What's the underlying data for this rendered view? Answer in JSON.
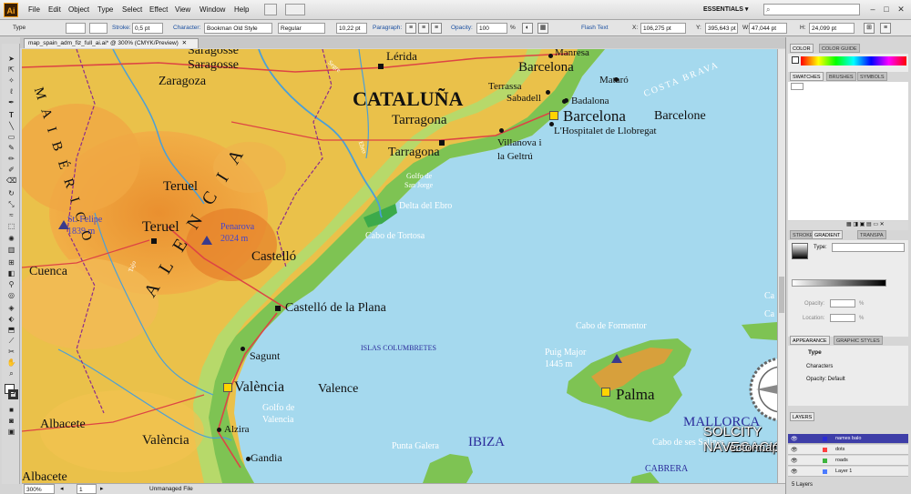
{
  "app": {
    "logo": "Ai",
    "menus": [
      "File",
      "Edit",
      "Object",
      "Type",
      "Select",
      "Effect",
      "View",
      "Window",
      "Help"
    ],
    "workspace": "ESSENTIALS ▾",
    "search_placeholder": "",
    "win_buttons": [
      "–",
      "□",
      "✕"
    ]
  },
  "control": {
    "type_label": "Type",
    "stroke_label": "Stroke:",
    "stroke_value": "0,5 pt",
    "character_label": "Character:",
    "font": "Bookman Old Style",
    "style": "Regular",
    "size": "10,22 pt",
    "paragraph_label": "Paragraph:",
    "opacity_label": "Opacity:",
    "opacity": "100",
    "opacity_unit": "%",
    "flash_label": "Flash Text",
    "x_label": "X:",
    "x": "106,275 pt",
    "y_label": "Y:",
    "y": "395,643 pt",
    "w_label": "W:",
    "w": "47,044 pt",
    "h_label": "H:",
    "h": "24,099 pt"
  },
  "document": {
    "tab": "map_spain_adm_fiz_full_ai.ai* @ 300% (CMYK/Preview)",
    "close": "✕"
  },
  "status": {
    "zoom": "300%",
    "page": "1",
    "info": "Unmanaged File"
  },
  "panels": {
    "color_tabs": [
      "COLOR",
      "COLOR GUIDE"
    ],
    "swatch_tabs": [
      "SWATCHES",
      "BRUSHES",
      "SYMBOLS"
    ],
    "stroke_tabs": [
      "STROKE",
      "GRADIENT",
      "TRANSPA"
    ],
    "type_label": "Type:",
    "opacity_label": "Opacity:",
    "location_label": "Location:",
    "pct": "%",
    "appearance_tabs": [
      "APPEARANCE",
      "GRAPHIC STYLES"
    ],
    "appearance_items": [
      "Type",
      "Characters",
      "Opacity: Default"
    ],
    "layers_tab": "LAYERS",
    "layers": [
      {
        "name": "names balo",
        "color": "#2b2bd6"
      },
      {
        "name": "dots",
        "color": "#ff4040"
      },
      {
        "name": "roads",
        "color": "#3cb43c"
      },
      {
        "name": "Layer 1",
        "color": "#4b7bff"
      }
    ],
    "layers_count": "5 Layers"
  },
  "map": {
    "labels": [
      {
        "t": "Saragosse",
        "c": "#111"
      },
      {
        "t": "Zaragoza",
        "c": "#111"
      },
      {
        "t": "Lérida",
        "c": "#111"
      },
      {
        "t": "Manresa",
        "c": "#111"
      },
      {
        "t": "Barcelona",
        "c": "#111"
      },
      {
        "t": "Terrassa",
        "c": "#111"
      },
      {
        "t": "Sabadell",
        "c": "#111"
      },
      {
        "t": "Mataró",
        "c": "#111"
      },
      {
        "t": "Badalona",
        "c": "#111"
      },
      {
        "t": "CATALUÑA",
        "c": "#111"
      },
      {
        "t": "Tarragona",
        "c": "#111"
      },
      {
        "t": "Tarragona",
        "c": "#111"
      },
      {
        "t": "Barcelona",
        "c": "#111"
      },
      {
        "t": "Barcelone",
        "c": "#111"
      },
      {
        "t": "L'Hospitalet de Llobregat",
        "c": "#111"
      },
      {
        "t": "Villanova i",
        "c": "#111"
      },
      {
        "t": "la Geltrú",
        "c": "#111"
      },
      {
        "t": "Golfo de",
        "c": "#fff"
      },
      {
        "t": "San Jorge",
        "c": "#fff"
      },
      {
        "t": "Delta del Ebro",
        "c": "#fff"
      },
      {
        "t": "Cabo de Tortosa",
        "c": "#fff"
      },
      {
        "t": "Teruel",
        "c": "#111"
      },
      {
        "t": "Teruel",
        "c": "#111"
      },
      {
        "t": "St. Felipe",
        "c": "#4444cc"
      },
      {
        "t": "1839 m",
        "c": "#4444cc"
      },
      {
        "t": "Penarova",
        "c": "#4444cc"
      },
      {
        "t": "2024 m",
        "c": "#4444cc"
      },
      {
        "t": "Castelló",
        "c": "#111"
      },
      {
        "t": "Cuenca",
        "c": "#111"
      },
      {
        "t": "Castelló de la Plana",
        "c": "#111"
      },
      {
        "t": "Sagunt",
        "c": "#111"
      },
      {
        "t": "ISLAS COLUMBRETES",
        "c": "#2a2a9a"
      },
      {
        "t": "Cabo de Formentor",
        "c": "#fff"
      },
      {
        "t": "Puig Major",
        "c": "#fff"
      },
      {
        "t": "1445 m",
        "c": "#fff"
      },
      {
        "t": "Palma",
        "c": "#111"
      },
      {
        "t": "València",
        "c": "#111"
      },
      {
        "t": "Valence",
        "c": "#111"
      },
      {
        "t": "Golfo de",
        "c": "#fff"
      },
      {
        "t": "Valencia",
        "c": "#fff"
      },
      {
        "t": "Albacete",
        "c": "#111"
      },
      {
        "t": "València",
        "c": "#111"
      },
      {
        "t": "Alzira",
        "c": "#111"
      },
      {
        "t": "Gandia",
        "c": "#111"
      },
      {
        "t": "Punta Galera",
        "c": "#fff"
      },
      {
        "t": "IBIZA",
        "c": "#2a2a9a"
      },
      {
        "t": "MALLORCA",
        "c": "#2a2a9a"
      },
      {
        "t": "Cabo de ses Salines",
        "c": "#fff"
      },
      {
        "t": "CABRERA",
        "c": "#2a2a9a"
      },
      {
        "t": "Albacete",
        "c": "#111"
      },
      {
        "t": "Ca",
        "c": "#fff"
      },
      {
        "t": "Ca",
        "c": "#fff"
      },
      {
        "t": "COSTA BRAVA",
        "c": "#fff"
      },
      {
        "t": "A L E N C I A",
        "c": "#111"
      },
      {
        "t": "M A I B É R I C O",
        "c": "#111"
      },
      {
        "t": "Tajo",
        "c": "#fff"
      },
      {
        "t": "Ebro",
        "c": "#fff"
      },
      {
        "t": "Segre",
        "c": "#fff"
      }
    ]
  },
  "watermark": {
    "line1": "SOLCITY NAVEGACION",
    "line2": "vectormap.info"
  }
}
